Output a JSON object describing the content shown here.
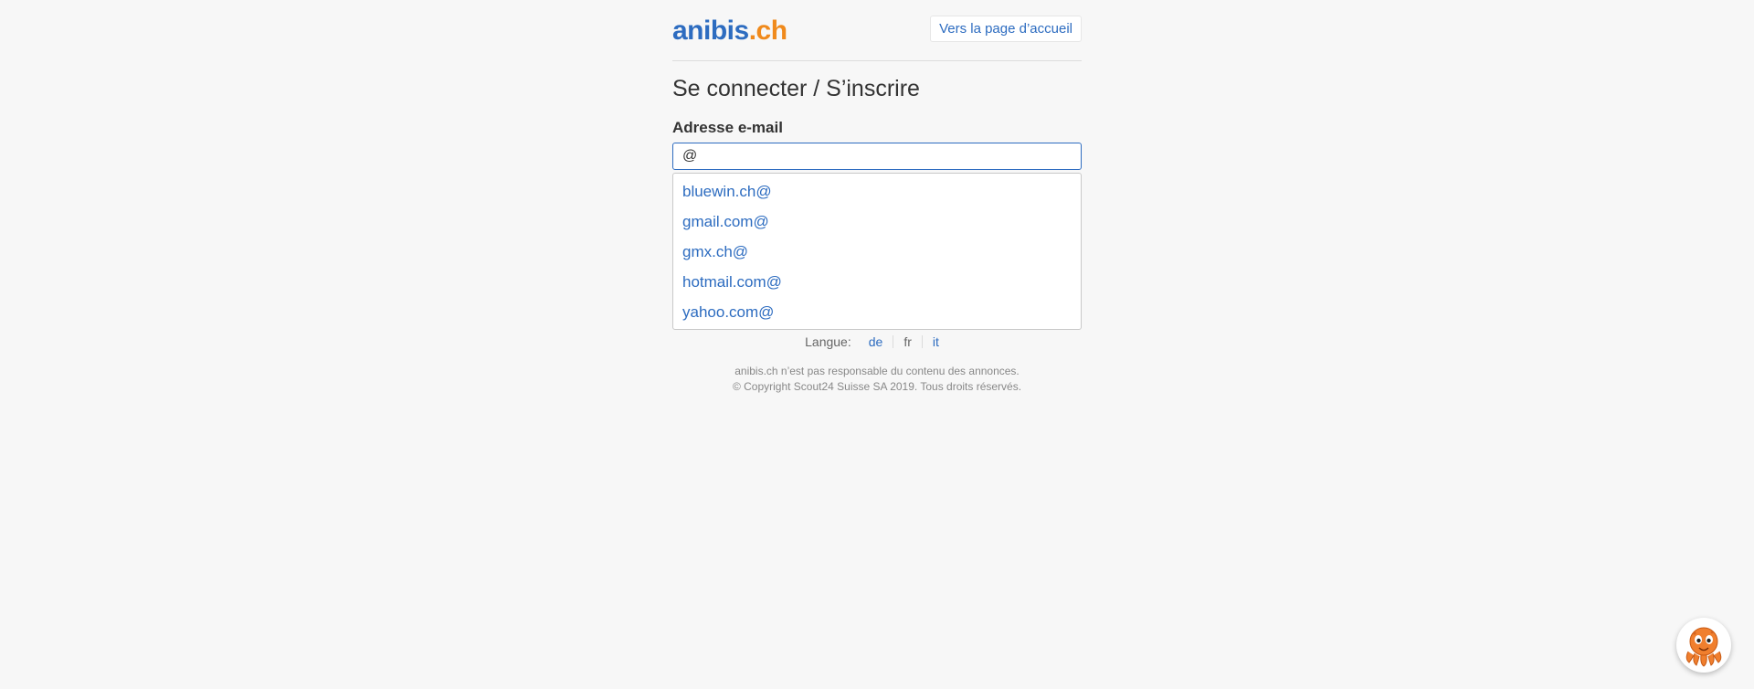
{
  "header": {
    "logo_brand": "anibis",
    "logo_tld": ".ch",
    "home_link": "Vers la page d’accueil"
  },
  "main": {
    "title": "Se connecter / S’inscrire",
    "email_label": "Adresse e-mail",
    "email_value": "@",
    "suggestions": [
      "bluewin.ch@",
      "gmail.com@",
      "gmx.ch@",
      "hotmail.com@",
      "yahoo.com@"
    ]
  },
  "language": {
    "label": "Langue:",
    "options": [
      {
        "code": "de",
        "active": false
      },
      {
        "code": "fr",
        "active": true
      },
      {
        "code": "it",
        "active": false
      }
    ]
  },
  "footer": {
    "line1": "anibis.ch n’est pas responsable du contenu des annonces.",
    "line2": "© Copyright Scout24 Suisse SA 2019. Tous droits réservés."
  },
  "colors": {
    "link": "#2d6cc0",
    "logo_accent": "#f08a1c",
    "mascot": "#f07f2e"
  },
  "icons": {
    "mascot": "octopus-mascot-icon"
  }
}
